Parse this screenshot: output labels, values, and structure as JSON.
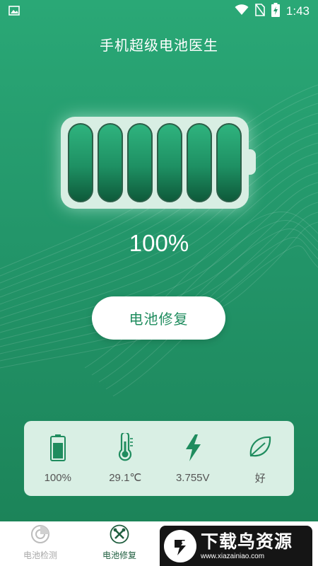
{
  "status_bar": {
    "time": "1:43",
    "icons": [
      "image-icon",
      "wifi-icon",
      "no-sim-icon",
      "battery-charging-icon"
    ]
  },
  "app": {
    "title": "手机超级电池医生"
  },
  "battery": {
    "level": 1.0,
    "percent_label": "100%",
    "cells_total": 6,
    "cells_filled": 6
  },
  "actions": {
    "repair_label": "电池修复"
  },
  "stats": [
    {
      "icon": "battery-icon",
      "value": "100%"
    },
    {
      "icon": "thermometer-icon",
      "value": "29.1℃"
    },
    {
      "icon": "lightning-icon",
      "value": "3.755V"
    },
    {
      "icon": "leaf-icon",
      "value": "好"
    }
  ],
  "nav": {
    "items": [
      {
        "label": "电池检测",
        "icon": "battery-check-icon",
        "active": false
      },
      {
        "label": "电池修复",
        "icon": "repair-tools-icon",
        "active": true
      }
    ]
  },
  "watermark": {
    "title": "下载鸟资源",
    "url": "www.xiazainiao.com"
  },
  "colors": {
    "primary_green": "#23966a",
    "panel_bg": "#d9efe4",
    "button_text": "#1f8c5e",
    "nav_active": "#1f5e3f",
    "nav_inactive": "#a8a8a8"
  }
}
